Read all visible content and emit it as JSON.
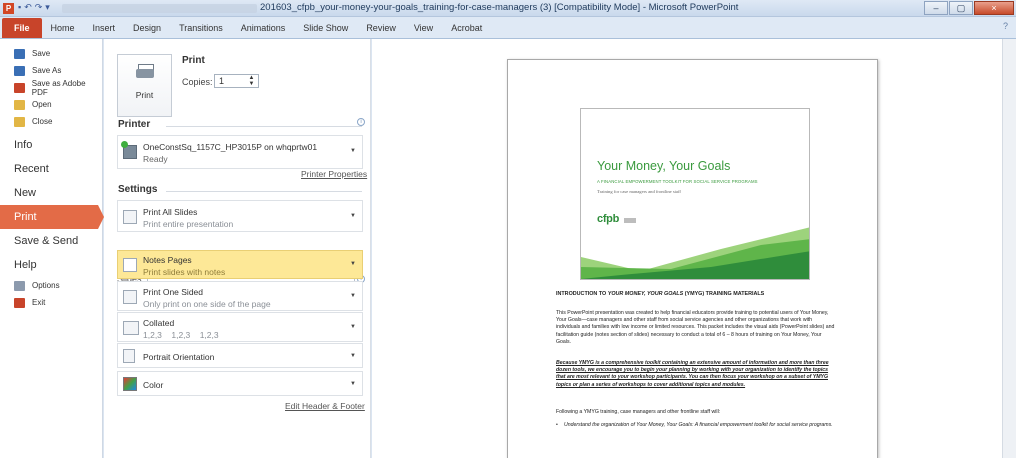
{
  "window": {
    "app_icon": "P",
    "quick_access": [
      "▪",
      "↶",
      "↷",
      "▾"
    ],
    "title": "201603_cfpb_your-money-your-goals_training-for-case-managers (3) [Compatibility Mode] - Microsoft PowerPoint",
    "buttons": [
      "–",
      "▢",
      "×"
    ]
  },
  "ribbon": {
    "tabs": [
      "File",
      "Home",
      "Insert",
      "Design",
      "Transitions",
      "Animations",
      "Slide Show",
      "Review",
      "View",
      "Acrobat"
    ],
    "help": "?"
  },
  "nav": {
    "small_top": [
      {
        "label": "Save",
        "icon": "save-icon",
        "color": "#3a6fb5"
      },
      {
        "label": "Save As",
        "icon": "save-as-icon",
        "color": "#3a6fb5"
      },
      {
        "label": "Save as Adobe PDF",
        "icon": "pdf-icon",
        "color": "#c8442a"
      },
      {
        "label": "Open",
        "icon": "open-folder-icon",
        "color": "#e2b645"
      },
      {
        "label": "Close",
        "icon": "close-folder-icon",
        "color": "#e2b645"
      }
    ],
    "large": [
      "Info",
      "Recent",
      "New",
      "Print",
      "Save & Send",
      "Help"
    ],
    "active": "Print",
    "small_bottom": [
      {
        "label": "Options",
        "icon": "options-icon",
        "color": "#8c9aad"
      },
      {
        "label": "Exit",
        "icon": "exit-icon",
        "color": "#c8442a"
      }
    ],
    "active_color": "#e36b47"
  },
  "print_panel": {
    "print_button": "Print",
    "heading": "Print",
    "copies_label": "Copies:",
    "copies_value": "1",
    "printer_heading": "Printer",
    "printer_name": "OneConstSq_1157C_HP3015P on whqprtw01",
    "printer_status": "Ready",
    "printer_properties": "Printer Properties",
    "settings_heading": "Settings",
    "slides_label": "Slides:",
    "options": [
      {
        "title": "Print All Slides",
        "sub": "Print entire presentation",
        "icon": "slides-icon"
      },
      {
        "title": "Notes Pages",
        "sub": "Print slides with notes",
        "icon": "notes-page-icon",
        "highlight": true
      },
      {
        "title": "Print One Sided",
        "sub": "Only print on one side of the page",
        "icon": "one-sided-icon"
      },
      {
        "title": "Collated",
        "sub": "1,2,3    1,2,3    1,2,3",
        "icon": "collated-icon"
      },
      {
        "title": "Portrait Orientation",
        "sub": "",
        "icon": "portrait-icon"
      },
      {
        "title": "Color",
        "sub": "",
        "icon": "color-icon"
      }
    ],
    "edit_header_footer": "Edit Header & Footer"
  },
  "preview": {
    "slide_title": "Your Money, Your Goals",
    "slide_subtitle": "A FINANCIAL EMPOWERMENT TOOLKIT FOR SOCIAL SERVICE PROGRAMS",
    "slide_subtitle2": "Training for case managers and frontline staff",
    "logo_text": "cfpb",
    "accent_color": "#3a9a3e",
    "heading_pre": "INTRODUCTION TO ",
    "heading_italic": "YOUR MONEY, YOUR GOALS",
    "heading_post": " (YMYG) TRAINING MATERIALS",
    "para1": "This PowerPoint presentation was created to help financial educators provide training to potential users of Your Money, Your Goals—case managers and other staff from social service agencies and other organizations that work with individuals and families with low income or limited resources. This packet includes the visual aids (PowerPoint slides) and facilitation guide (notes section of slides) necessary to conduct a total of 6 – 8 hours of training on Your Money, Your Goals.",
    "para2": "Because YMYG is a comprehensive toolkit containing an extensive amount of information and more than three dozen tools, we encourage you to begin your planning by working with your organization to identify the topics that are most relevant to your workshop participants. You can then focus your workshop on a subset of YMYG topics or plan a series of workshops to cover additional topics and modules.",
    "para3": "Following a YMYG training, case managers and other frontline staff will:",
    "bullet1": "Understand the organization of Your Money, Your Goals: A financial empowerment toolkit for social service programs."
  }
}
